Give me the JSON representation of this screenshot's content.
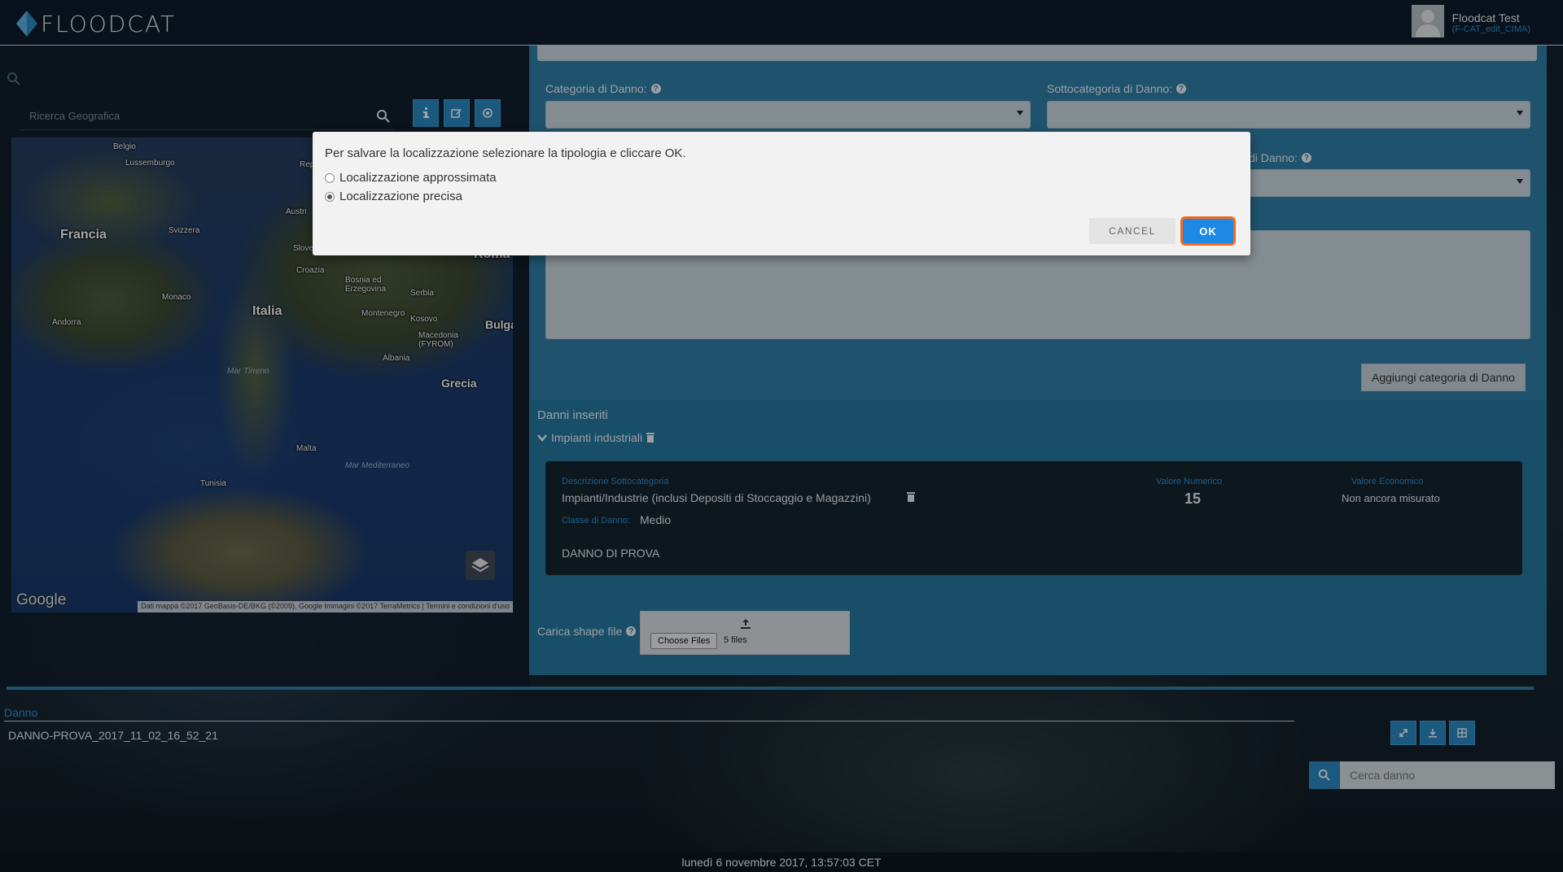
{
  "app": {
    "logo_text": "FLOODCAT"
  },
  "user": {
    "name": "Floodcat Test",
    "role": "(F-CAT_edit_CIMA)"
  },
  "left": {
    "geo_search_placeholder": "Ricerca Geografica",
    "tools": [
      "info-icon",
      "edit-icon",
      "target-icon"
    ]
  },
  "map": {
    "labels": {
      "belgio": "Belgio",
      "lussemburgo": "Lussemburgo",
      "francia": "Francia",
      "svizzera": "Svizzera",
      "austria": "Austri",
      "rep": "Rep",
      "slovenia": "Slovenia",
      "croazia": "Croazia",
      "bosnia": "Bosnia ed Erzegovina",
      "serbia": "Serbia",
      "monaco": "Monaco",
      "andorra": "Andorra",
      "italia": "Italia",
      "roma": "Roma",
      "montenegro": "Montenegro",
      "kosovo": "Kosovo",
      "bulgaria": "Bulga",
      "macedonia": "Macedonia (FYROM)",
      "albania": "Albania",
      "grecia": "Grecia",
      "mar_tirreno": "Mar Tirreno",
      "malta": "Malta",
      "mar_mediterraneo": "Mar Mediterraneo",
      "tunisia": "Tunisia"
    },
    "google": "Google",
    "attribution": "Dati mappa ©2017 GeoBasis-DE/BKG (©2009), Google Immagini ©2017 TerraMetrics | Termini e condizioni d'uso"
  },
  "form": {
    "categoria_label": "Categoria di Danno:",
    "sottocategoria_label": "Sottocategoria di Danno:",
    "classe_label": "di Danno:",
    "add_category_button": "Aggiungi categoria di Danno",
    "danni_inseriti": "Danni inseriti",
    "group_label": "Impianti industriali",
    "card": {
      "desc_label": "Descrizione Sottocategoria",
      "desc_value": "Impianti/Industrie (inclusi Depositi di Stoccaggio e Magazzini)",
      "classe_label": "Classe di Danno:",
      "classe_value": "Medio",
      "note": "DANNO DI PROVA",
      "valore_numerico_label": "Valore Numerico",
      "valore_numerico": "15",
      "valore_economico_label": "Valore Economico",
      "valore_economico": "Non ancora misurato"
    },
    "shape_label": "Carica shape file",
    "choose_files": "Choose Files",
    "files_count": "5 files"
  },
  "bottom": {
    "tab_label": "Danno",
    "damage_name": "DANNO-PROVA_2017_11_02_16_52_21",
    "search_placeholder": "Cerca danno",
    "datetime": "lunedì 6 novembre 2017, 13:57:03 CET"
  },
  "modal": {
    "message": "Per salvare la localizzazione selezionare la tipologia e cliccare OK.",
    "option_approx": "Localizzazione approssimata",
    "option_precise": "Localizzazione precisa",
    "selected": "precise",
    "cancel_label": "CANCEL",
    "ok_label": "OK"
  },
  "colors": {
    "accent": "#2a89c2",
    "ok_button": "#1e88e5",
    "ok_highlight": "#f26b1d"
  }
}
